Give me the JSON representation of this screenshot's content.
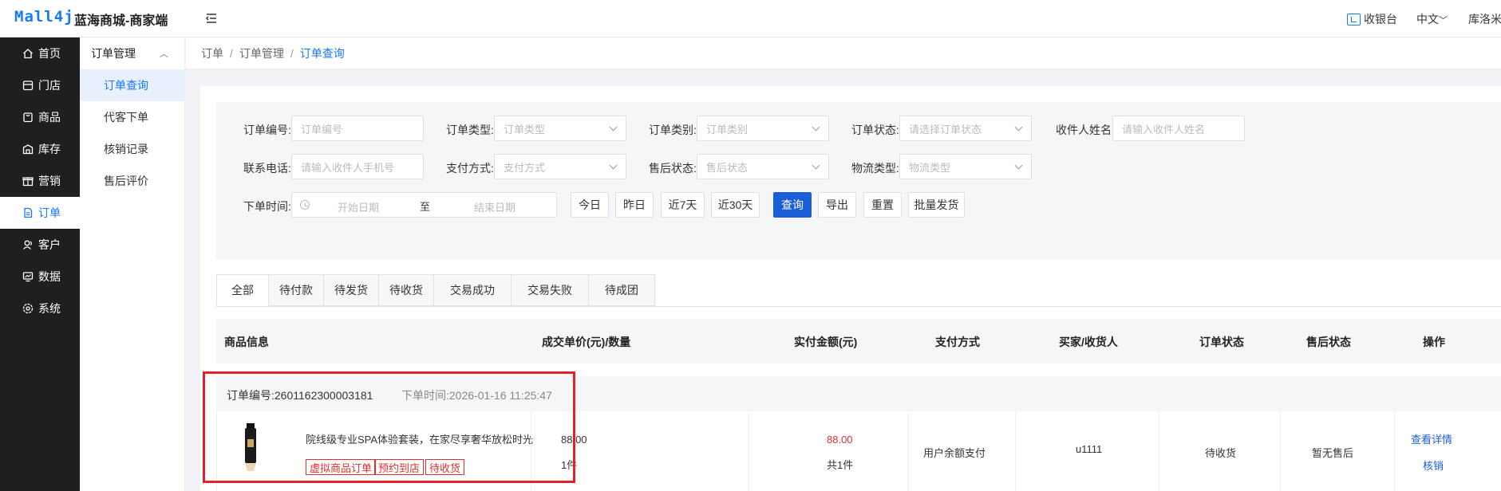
{
  "header": {
    "logo": "Mall4j",
    "shop_name": "蓝海商城-商家端",
    "cashier": "收银台",
    "language": "中文",
    "user": "库洛米"
  },
  "nav": {
    "main": [
      {
        "label": "首页",
        "icon": "home-icon"
      },
      {
        "label": "门店",
        "icon": "store-icon"
      },
      {
        "label": "商品",
        "icon": "goods-icon"
      },
      {
        "label": "库存",
        "icon": "inventory-icon"
      },
      {
        "label": "营销",
        "icon": "marketing-icon"
      },
      {
        "label": "订单",
        "icon": "order-icon"
      },
      {
        "label": "客户",
        "icon": "customer-icon"
      },
      {
        "label": "数据",
        "icon": "data-icon"
      },
      {
        "label": "系统",
        "icon": "system-icon"
      }
    ],
    "active_main": "订单",
    "sub_header": "订单管理",
    "sub": [
      "订单查询",
      "代客下单",
      "核销记录",
      "售后评价"
    ],
    "active_sub": "订单查询"
  },
  "breadcrumb": [
    "订单",
    "订单管理",
    "订单查询"
  ],
  "filters": {
    "order_no": {
      "label": "订单编号:",
      "placeholder": "订单编号"
    },
    "order_type": {
      "label": "订单类型:",
      "placeholder": "订单类型"
    },
    "order_category": {
      "label": "订单类别:",
      "placeholder": "订单类别"
    },
    "order_status": {
      "label": "订单状态:",
      "placeholder": "请选择订单状态"
    },
    "receiver_name": {
      "label": "收件人姓名:",
      "placeholder": "请输入收件人姓名"
    },
    "phone": {
      "label": "联系电话:",
      "placeholder": "请输入收件人手机号"
    },
    "pay_type": {
      "label": "支付方式:",
      "placeholder": "支付方式"
    },
    "after_sale": {
      "label": "售后状态:",
      "placeholder": "售后状态"
    },
    "logistics": {
      "label": "物流类型:",
      "placeholder": "物流类型"
    },
    "order_time": {
      "label": "下单时间:",
      "start": "开始日期",
      "to": "至",
      "end": "结束日期"
    }
  },
  "buttons": {
    "today": "今日",
    "yesterday": "昨日",
    "last7": "近7天",
    "last30": "近30天",
    "query": "查询",
    "export": "导出",
    "reset": "重置",
    "batch_ship": "批量发货"
  },
  "tabs": [
    "全部",
    "待付款",
    "待发货",
    "待收货",
    "交易成功",
    "交易失败",
    "待成团"
  ],
  "active_tab": "全部",
  "columns": {
    "product": "商品信息",
    "price_qty": "成交单价(元)/数量",
    "paid": "实付金额(元)",
    "pay_method": "支付方式",
    "buyer": "买家/收货人",
    "status": "订单状态",
    "after_sale": "售后状态",
    "actions": "操作"
  },
  "order": {
    "order_no": "订单编号:2601162300003181",
    "order_time": "下单时间:2026-01-16 11:25:47",
    "product_name": "院线级专业SPA体验套装，在家尽享奢华放松时光",
    "tags": [
      "虚拟商品订单",
      "预约到店",
      "待收货"
    ],
    "price": "88.00",
    "qty": "1件",
    "paid": "88.00",
    "paid_count": "共1件",
    "pay_method": "用户余额支付",
    "buyer": "u1111",
    "status": "待收货",
    "after_sale": "暂无售后",
    "action_detail": "查看详情",
    "action_verify": "核销"
  },
  "colors": {
    "accent": "#1677ff",
    "primary_button": "#1a5fd8",
    "sidebar_bg": "#1f1f1f",
    "price_red": "#e03030",
    "highlight_red": "#e4202a"
  }
}
